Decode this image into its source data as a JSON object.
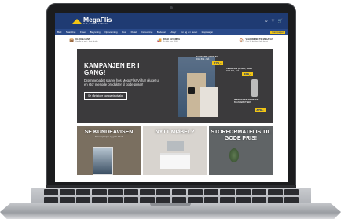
{
  "site": {
    "logo_name": "MegaFlis",
    "logo_tagline": "FLIS, BAD OG KJØKKEN"
  },
  "nav": {
    "items": [
      "Bad",
      "Sparkling",
      "Fliser",
      "Belysning",
      "Oppvarming",
      "Dusj",
      "Flotell",
      "Innredning",
      "Badekar",
      "Utstyr",
      "Inn og ut i huset",
      "Fliser, Lekker Badekar",
      "Inspirasjon"
    ],
    "highlight": "Kampanjer"
  },
  "usps": [
    {
      "icon": "pickup-icon",
      "title": "KLIKK & HENT",
      "text": "Handle på nett – hent i butikk"
    },
    {
      "icon": "delivery-icon",
      "title": "RASK LEVERING",
      "text": "Fri frakt over 1500,-"
    },
    {
      "icon": "store-icon",
      "title": "VELKOMMEN TIL MEGAFLIS",
      "text": "Over 50 butikker i hele landet"
    }
  ],
  "hero": {
    "title": "KAMPANJEN ER I GANG!",
    "text": "Drømmebadet starter hos MegaFlis! Vi har pluket ut en stor mengde produkter til gode priser!",
    "button": "Se vårt store kampanjeutvalg!",
    "tag1_title": "FLISSERIE ARTISAN",
    "tag1_sub": "FRA 599,- MÅ",
    "tag1_price": "279,-",
    "tag2_title": "VEGGFLIS STONY, SORT",
    "tag2_sub": "FRA 399,- MÅ",
    "tag2_price": "899,-",
    "tag3_title": "INNBYGGET ARMATUR",
    "tag3_sub": "BLANDEBATTERI",
    "tag3_price": "479,-"
  },
  "tiles": [
    {
      "title": "SE KUNDEAVISEN",
      "sub": "Finn inspirasjon og gode tilbud"
    },
    {
      "title": "NYTT MØBEL?",
      "sub": ""
    },
    {
      "title": "STORFORMATFLIS TIL GODE PRIS!",
      "sub": ""
    }
  ],
  "header_icons": [
    "user-icon",
    "heart-icon",
    "cart-icon"
  ]
}
